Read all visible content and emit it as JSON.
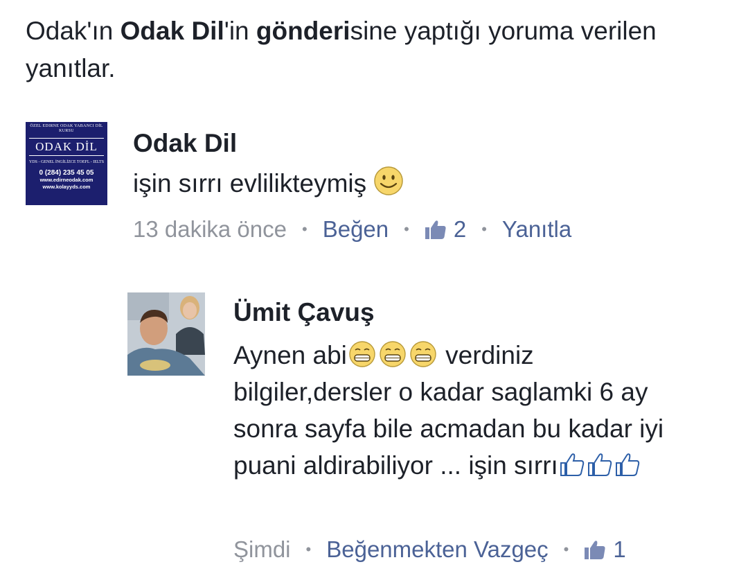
{
  "header": {
    "part1": "Odak'ın ",
    "page_name": "Odak Dil",
    "part2": "'in ",
    "post_word": "gönderi",
    "part3": "sine yaptığı yoruma verilen yanıtlar."
  },
  "comments": [
    {
      "author": "Odak Dil",
      "avatar": {
        "line1": "ÖZEL EDIRNE ODAK YABANCI DİL KURSU",
        "brand": "ODAK DİL",
        "line2": "YDS - GENEL İNGİLİZCE TOEFL - IELTS",
        "phone": "0 (284) 235 45 05",
        "web1": "www.edirneodak.com",
        "web2": "www.kolayyds.com"
      },
      "text": "işin sırrı evlilikteymiş",
      "emoji": "smile-emoji",
      "time": "13 dakika önce",
      "like_label": "Beğen",
      "like_count": "2",
      "reply_label": "Yanıtla"
    },
    {
      "author": "Ümit Çavuş",
      "text_part1": "Aynen abi",
      "emojis_part1": [
        "grin-emoji",
        "grin-emoji",
        "grin-emoji"
      ],
      "text_part2": " verdiniz bilgiler,dersler o kadar saglamki 6 ay sonra sayfa bile acmadan bu kadar iyi puani aldirabiliyor ... işin sırrı",
      "emojis_part2": [
        "thumbs-up-emoji",
        "thumbs-up-emoji",
        "thumbs-up-emoji"
      ],
      "time": "Şimdi",
      "unlike_label": "Beğenmekten Vazgeç",
      "like_count": "1"
    }
  ],
  "colors": {
    "text": "#1d2129",
    "meta_gray": "#90949c",
    "link_blue": "#4b6296",
    "avatar_navy": "#1c1f6e",
    "emoji_yellow": "#f7d66a"
  }
}
